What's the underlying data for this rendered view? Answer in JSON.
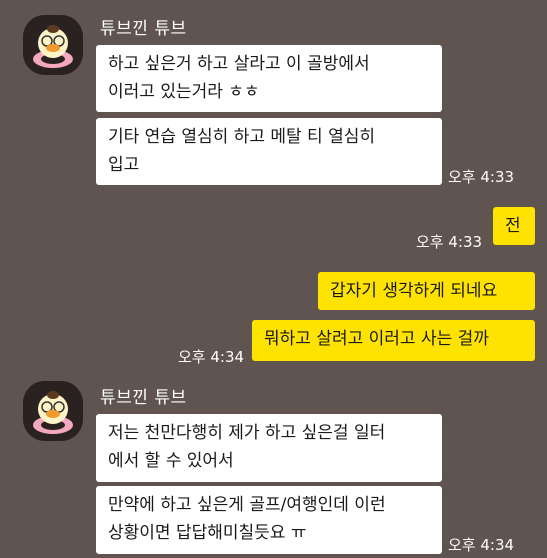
{
  "colors": {
    "background": "#5f5450",
    "incoming_bubble": "#ffffff",
    "outgoing_bubble": "#ffe300"
  },
  "groups": [
    {
      "sender": "튜브낀 튜브",
      "avatar_icon": "duck-character-avatar",
      "messages": [
        {
          "text": "하고 싶은거 하고 살라고 이 골방에서\n이러고 있는거라 ㅎㅎ"
        },
        {
          "text": "기타 연습 열심히 하고 메탈 티 열심히\n입고",
          "time": "오후 4:33"
        }
      ]
    },
    {
      "sender": "",
      "outgoing": true,
      "messages": [
        {
          "text": "전",
          "time": "오후 4:33"
        },
        {
          "text": "갑자기 생각하게 되네요"
        },
        {
          "text": "뭐하고 살려고 이러고 사는 걸까",
          "time": "오후 4:34"
        }
      ]
    },
    {
      "sender": "튜브낀 튜브",
      "avatar_icon": "duck-character-avatar",
      "messages": [
        {
          "text": "저는 천만다행히 제가 하고 싶은걸 일터\n에서 할 수 있어서"
        },
        {
          "text": "만약에 하고 싶은게 골프/여행인데 이런\n상황이면 답답해미칠듯요 ㅠ",
          "time": "오후 4:34"
        }
      ]
    }
  ]
}
